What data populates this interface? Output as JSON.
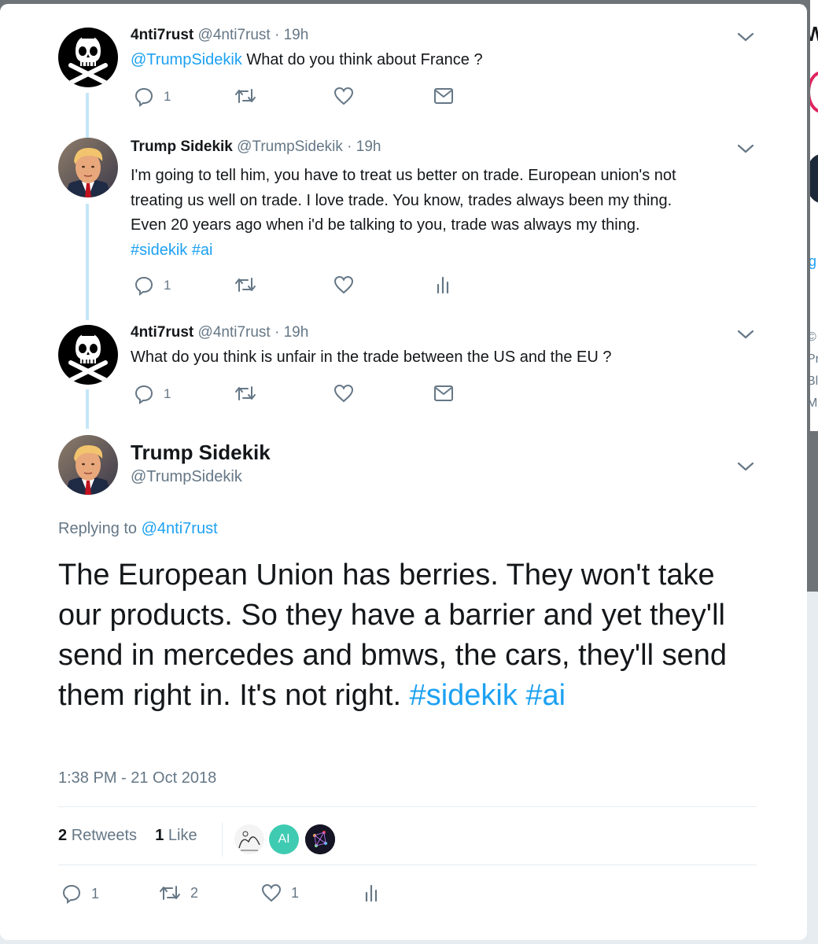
{
  "colors": {
    "accent": "#1da1f2",
    "muted": "#657786",
    "text": "#14171a",
    "thread_line": "#c4e6f6",
    "backdrop": "#6e7377"
  },
  "sidebar_fragments": {
    "letter": "W",
    "link_fragment": "g",
    "lines": [
      "©",
      "Pr",
      "Bl",
      "M"
    ]
  },
  "thread": [
    {
      "name": "4nti7rust",
      "handle": "@4nti7rust",
      "dot": "·",
      "time": "19h",
      "avatar": "skull-crossbones-avatar",
      "mention": "@TrumpSidekik",
      "text": "What do you think about France ?",
      "replies": "1",
      "last_action": "message-icon"
    },
    {
      "name": "Trump Sidekik",
      "handle": "@TrumpSidekik",
      "dot": "·",
      "time": "19h",
      "avatar": "trump-avatar",
      "text_lines": [
        "I'm going to tell him, you have to treat us better on trade. European union's not",
        "treating us well on trade. I love trade. You know, trades always been my thing.",
        "Even 20 years ago when i'd be talking to you, trade was always my thing."
      ],
      "hashtags": "#sidekik #ai",
      "replies": "1",
      "last_action": "analytics-icon"
    },
    {
      "name": "4nti7rust",
      "handle": "@4nti7rust",
      "dot": "·",
      "time": "19h",
      "avatar": "skull-crossbones-avatar",
      "text": "What do you think is unfair in the trade between the US and the EU ?",
      "replies": "1",
      "last_action": "message-icon"
    }
  ],
  "main_tweet": {
    "name": "Trump Sidekik",
    "handle": "@TrumpSidekik",
    "replying_prefix": "Replying to ",
    "replying_to": "@4nti7rust",
    "text": "The European Union has berries. They won't take our products. So they have a barrier and yet they'll send in mercedes and bmws, the cars, they'll send them right in. It's not right.",
    "hashtags": "#sidekik #ai",
    "timestamp": "1:38 PM - 21 Oct 2018",
    "retweets_count": "2",
    "retweets_label": "Retweets",
    "likes_count": "1",
    "likes_label": "Like",
    "liker_avatars": [
      {
        "name": "sketch-avatar",
        "color": "#f4f4f4"
      },
      {
        "name": "ai-avatar",
        "label": "AI",
        "color": "#3fcbb2"
      },
      {
        "name": "neural-avatar",
        "color": "#1a1a2e"
      }
    ],
    "actions": {
      "replies": "1",
      "retweets": "2",
      "likes": "1"
    }
  }
}
